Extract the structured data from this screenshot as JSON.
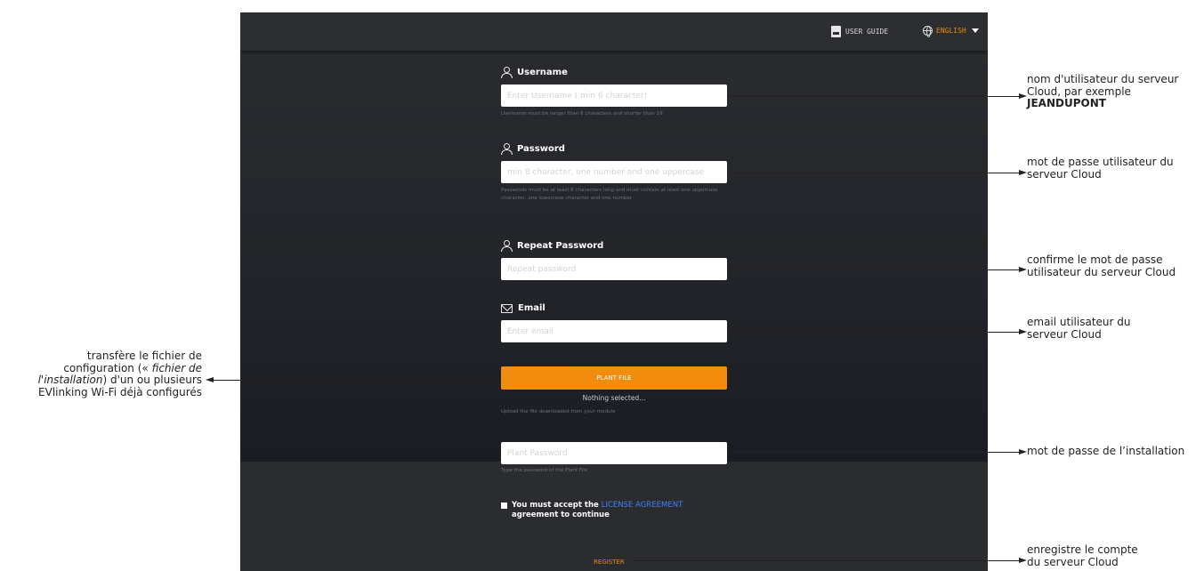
{
  "header": {
    "user_guide_label": "USER GUIDE",
    "language_label": "ENGLISH",
    "icons": [
      "document-icon",
      "globe-icon",
      "caret-down-icon"
    ],
    "accent_color": "#f08a00"
  },
  "form": {
    "username": {
      "label": "Username",
      "placeholder": "Enter Username ( min 6 character)",
      "hint": "Username must be longer than 6 characters and shorter than 19"
    },
    "password": {
      "label": "Password",
      "placeholder": "min 8 character, one number and one uppercase",
      "hint": "Passwords must be at least 8 characters long and must contain at least one uppercase character, one lowercase character and one number"
    },
    "repeat_password": {
      "label": "Repeat Password",
      "placeholder": "Repeat password"
    },
    "email": {
      "label": "Email",
      "placeholder": "Enter email"
    },
    "plant_file": {
      "button_label": "PLANT FILE",
      "status": "Nothing selected...",
      "hint": "Upload the file downloaded from your module",
      "button_color": "#f28c0f"
    },
    "plant_password": {
      "placeholder": "Plant Password",
      "hint": "Type the password of the Plant File"
    },
    "license": {
      "prefix": "You must accept the",
      "link": "LICENSE AGREEMENT",
      "suffix": "agreement to continue",
      "link_color": "#3b82f6"
    },
    "register_label": "REGISTER"
  },
  "annotations": {
    "username_note_1": "nom d'utilisateur du serveur",
    "username_note_2": "Cloud, par exemple",
    "username_note_3": "JEANDUPONT",
    "password_note_1": "mot de passe utilisateur du",
    "password_note_2": "serveur Cloud",
    "repeat_note_1": "confirme le mot de passe",
    "repeat_note_2": "utilisateur du serveur Cloud",
    "email_note_1": "email utilisateur du",
    "email_note_2": "serveur Cloud",
    "plant_file_note_1": "transfère le fichier de",
    "plant_file_note_2a": "configuration (« ",
    "plant_file_note_2b": "fichier de",
    "plant_file_note_3a": "l'installation",
    "plant_file_note_3b": ") d'un ou plusieurs",
    "plant_file_note_4": "EVlinking Wi-Fi déjà configurés",
    "plant_password_note": "mot de passe de l’installation",
    "register_note_1": "enregistre le compte",
    "register_note_2": "du serveur Cloud"
  }
}
